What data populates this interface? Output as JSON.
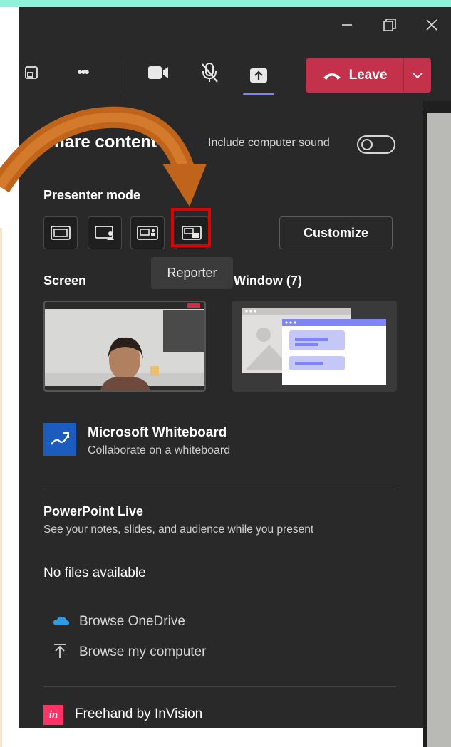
{
  "colors": {
    "accent": "#7f85f5",
    "leave": "#c4314b",
    "highlight": "#e00000",
    "arrow": "#c0641c"
  },
  "toolbar": {
    "icons": [
      "popout-icon",
      "more-icon",
      "camera-icon",
      "mic-off-icon",
      "share-icon"
    ],
    "more_label": "•••",
    "leave_label": "Leave"
  },
  "share": {
    "title": "Share content",
    "include_sound_label": "Include computer sound",
    "include_sound_on": false,
    "presenter_mode_label": "Presenter mode",
    "modes": [
      "Content only",
      "Standout",
      "Side-by-side",
      "Reporter"
    ],
    "selected_mode": "Reporter",
    "tooltip": "Reporter",
    "customize_label": "Customize",
    "screen_label": "Screen",
    "window_label": "Window (7)"
  },
  "whiteboard": {
    "title": "Microsoft Whiteboard",
    "subtitle": "Collaborate on a whiteboard"
  },
  "powerpoint": {
    "title": "PowerPoint Live",
    "subtitle": "See your notes, slides, and audience while you present",
    "no_files": "No files available"
  },
  "browse": {
    "onedrive": "Browse OneDrive",
    "computer": "Browse my computer"
  },
  "freehand": {
    "label": "Freehand by InVision",
    "icon_text": "in"
  }
}
